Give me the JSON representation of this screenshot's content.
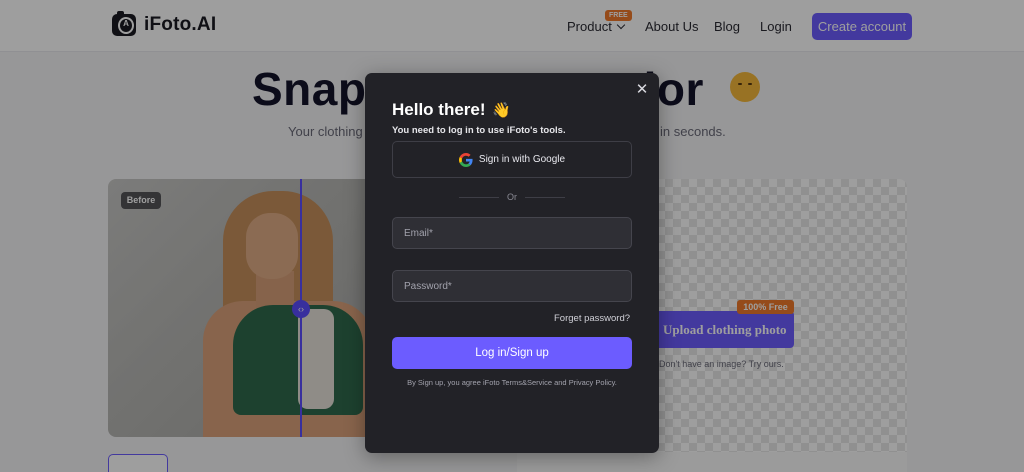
{
  "nav": {
    "brand": "iFoto.AI",
    "product_label": "Product",
    "product_badge": "FREE",
    "about_label": "About Us",
    "blog_label": "Blog",
    "login_label": "Login",
    "create_account_label": "Create account"
  },
  "hero": {
    "title_left": "Snap",
    "title_right": "olor",
    "subtitle_left": "Your clothing",
    "subtitle_right": "in seconds."
  },
  "preview": {
    "before_badge": "Before",
    "upload_button_label": "Upload clothing photo",
    "upload_badge": "100% Free",
    "try_text": "Don't have an image? Try ours."
  },
  "modal": {
    "title": "Hello there!",
    "subtitle": "You need to log in to use iFoto's tools.",
    "google_label": "Sign in with Google",
    "or_label": "Or",
    "email_placeholder": "Email*",
    "password_placeholder": "Password*",
    "forgot_label": "Forget password?",
    "submit_label": "Log in/Sign up",
    "terms_text": "By Sign up, you agree iFoto Terms&Service and Privacy Policy."
  },
  "colors": {
    "accent": "#6c5cff",
    "badge_orange": "#f07a2a",
    "modal_bg": "#222227"
  },
  "icons": {
    "close": "close-icon",
    "google": "google-icon",
    "wave": "waving-hand-icon",
    "party": "party-face-icon",
    "logo": "camera-logo-icon"
  }
}
